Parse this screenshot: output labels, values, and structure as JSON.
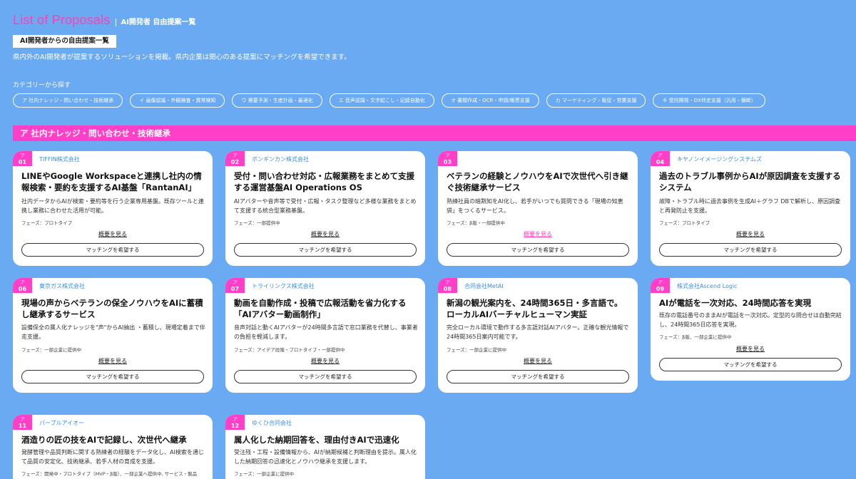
{
  "header": {
    "title": "List of Proposals",
    "subtitle": "AI開発者 自由提案一覧",
    "badge": "AI開発者からの自由提案一覧",
    "description": "県内外のAI開発者が提案するソリューションを掲載。県内企業は関心のある提案にマッチングを希望できます。"
  },
  "categories": {
    "label": "カテゴリーから探す",
    "items": [
      "ア 社内ナレッジ・問い合わせ・技術継承",
      "イ 画像認識・外観検査・異常検知",
      "ウ 需要予測・生産計画・最適化",
      "エ 音声認識・文字起こし・記録自動化",
      "オ 書類作成・OCR・申請/帳票支援",
      "カ マーケティング・販促・営業支援",
      "キ 受託開発・DX伴走支援（汎用・横断）"
    ]
  },
  "section": {
    "title": "ア 社内ナレッジ・問い合わせ・技術継承"
  },
  "labels": {
    "detail": "概要を見る",
    "match": "マッチングを希望する"
  },
  "cards": [
    {
      "cat": "ア",
      "num": "01",
      "company": "TIFFIN株式会社",
      "title": "LINEやGoogle Workspaceと連携し社内の情報検索・要約を支援するAI基盤「RantanAI」",
      "desc": "社内データからAIが検索・要約等を行う企業専用基盤。既存ツールと連携し業務に合わせた活用が可能。",
      "phase": "フェーズ：プロトタイプ"
    },
    {
      "cat": "ア",
      "num": "02",
      "company": "ボンギンカン株式会社",
      "title": "受付・問い合わせ対応・広報業務をまとめて支援する運営基盤AI Operations OS",
      "desc": "AIアバターや音声等で受付・広報・タスク整理など多様な業務をまとめて支援する統合型業務基盤。",
      "phase": "フェーズ：一部提供中"
    },
    {
      "cat": "ア",
      "num": "03",
      "company": "",
      "title": "ベテランの経験とノウハウをAIで次世代へ引き継ぐ技術継承サービス",
      "desc": "熟練社員の暗黙知をAI化し、若手がいつでも質問できる「現場の知恵袋」をつくるサービス。",
      "phase": "フェーズ：β版・一部提供中"
    },
    {
      "cat": "ア",
      "num": "04",
      "company": "キヤノンイメージングシステムズ",
      "title": "過去のトラブル事例からAIが原因調査を支援するシステム",
      "desc": "故障・トラブル時に過去事例を生成AI＋グラフ DBで解析し、原因調査と再発防止を支援。",
      "phase": "フェーズ：プロトタイプ"
    },
    {
      "cat": "ア",
      "num": "06",
      "company": "東京ガス株式会社",
      "title": "現場の声からベテランの保全ノウハウをAIに蓄積し継承するサービス",
      "desc": "設備保全の属人化ナレッジを\"声\"からAI抽出 ・蓄積し、現場定着まで伴走支援。",
      "phase": "フェーズ：一部企業に提供中"
    },
    {
      "cat": "ア",
      "num": "07",
      "company": "トライリンクス株式会社",
      "title": "動画を自動作成・投稿で広報活動を省力化する「AIアバター動画制作」",
      "desc": "音声対話と動くAIアバターが24時間多言語で窓口業務を代替し、事業者の負担を軽減します。",
      "phase": "フェーズ：アイデア段階・プロトタイプ・一部提供中"
    },
    {
      "cat": "ア",
      "num": "08",
      "company": "合同会社MetAI",
      "title": "新潟の観光案内を、24時間365日・多言語で。ローカルAIバーチャルヒューマン実証",
      "desc": "完全ローカル環境で動作する多言語対話AIアバター。正確な観光情報で24時間365日案内可能です。",
      "phase": "フェーズ：一部企業に提供中"
    },
    {
      "cat": "ア",
      "num": "09",
      "company": "株式会社Ascend Logic",
      "title": "AIが電話を一次対応、24時間応答を実現",
      "desc": "既存の電話番号のままAIが電話を一次対応。定型的な問合せは自動完結し、24時間365日応答を実現。",
      "phase": "フェーズ：β版、一部企業に提供中"
    },
    {
      "cat": "ア",
      "num": "11",
      "company": "パープルアイオー",
      "title": "酒造りの匠の技をAIで記録し、次世代へ継承",
      "desc": "発酵管理や品質判断に関する熟練者の経験をデータ化し、AI検索を通じて品質の安定化、技術継承、若手人材の育成を支援。",
      "phase": "フェーズ：開発中・プロトタイプ（MVP・β版）、一部企業へ提供中, サービス・製品"
    },
    {
      "cat": "ア",
      "num": "12",
      "company": "ゆくひ合同会社",
      "title": "属人化した納期回答を、理由付きAIで迅速化",
      "desc": "受注残・工程・設備情報から、AIが納期候補と判断理由を提示。属人化した納期回答の迅速化とノウハウ継承を支援します。",
      "phase": "フェーズ：一部企業に提供中"
    }
  ]
}
